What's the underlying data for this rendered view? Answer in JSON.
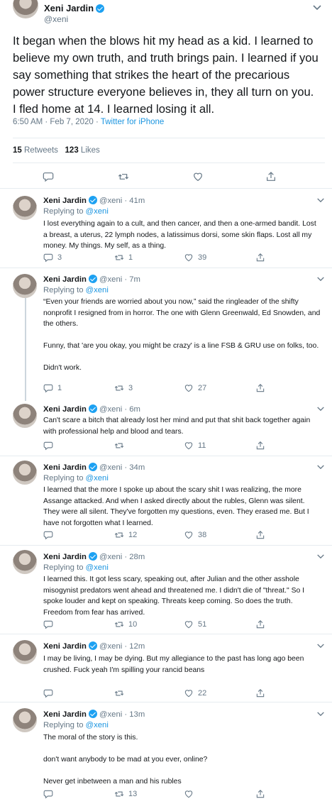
{
  "main": {
    "name": "Xeni Jardin",
    "handle": "@xeni",
    "text": "It began when the blows hit my head as a kid. I learned to believe my own truth, and truth brings pain. I learned if you say something that strikes the heart of the precarious power structure everyone believes in, they all turn on you. I fled home at 14. I learned losing it all.",
    "time": "6:50 AM · Feb 7, 2020 · ",
    "client": "Twitter for iPhone",
    "retweets_count": "15",
    "retweets_label": "Retweets",
    "likes_count": "123",
    "likes_label": "Likes"
  },
  "replies": [
    {
      "name": "Xeni Jardin",
      "handle": "@xeni · 41m",
      "replying_label": "Replying to ",
      "replying_to": "@xeni",
      "text": "I lost everything again to a cult, and then cancer, and then a one-armed bandit. Lost a breast, a uterus, 22 lymph nodes, a latissimus dorsi, some skin flaps. Lost all my money. My things. My self, as a thing.",
      "replies": "3",
      "retweets": "1",
      "likes": "39"
    },
    {
      "name": "Xeni Jardin",
      "handle": "@xeni · 7m",
      "replying_label": "Replying to ",
      "replying_to": "@xeni",
      "text": "“Even your friends are worried about you now,” said the ringleader of the shifty nonprofit I resigned from in horror. The one with Glenn Greenwald, Ed Snowden, and the others.\n\nFunny, that 'are you okay, you might be crazy' is a line FSB & GRU use on folks, too.\n\nDidn't work.",
      "replies": "1",
      "retweets": "3",
      "likes": "27"
    },
    {
      "name": "Xeni Jardin",
      "handle": "@xeni · 6m",
      "text": "Can't scare a bitch that already lost her mind and put that shit back together again with professional help and blood and tears.",
      "replies": "",
      "retweets": "",
      "likes": "11"
    },
    {
      "name": "Xeni Jardin",
      "handle": "@xeni · 34m",
      "replying_label": "Replying to ",
      "replying_to": "@xeni",
      "text": "I learned that the more I spoke up about the scary shit I was realizing, the more Assange attacked. And when I asked directly about the rubles, Glenn was silent. They were all silent. They've forgotten my questions, even. They erased me. But I have not forgotten what I learned.",
      "replies": "",
      "retweets": "12",
      "likes": "38"
    },
    {
      "name": "Xeni Jardin",
      "handle": "@xeni · 28m",
      "replying_label": "Replying to ",
      "replying_to": "@xeni",
      "text": "I learned this. It got less scary, speaking out, after Julian and the other asshole misogynist predators went ahead and threatened me. I didn't die of \"threat.\" So I spoke louder and kept on speaking. Threats keep coming. So does the truth. Freedom from fear has arrived.",
      "replies": "",
      "retweets": "10",
      "likes": "51"
    },
    {
      "name": "Xeni Jardin",
      "handle": "@xeni · 12m",
      "text": "I may be living, I may be dying. But my allegiance to the past has long ago been crushed. Fuck yeah I'm spilling your rancid beans",
      "replies": "",
      "retweets": "",
      "likes": "22"
    },
    {
      "name": "Xeni Jardin",
      "handle": "@xeni · 13m",
      "replying_label": "Replying to ",
      "replying_to": "@xeni",
      "text": "The moral of the story is this.\n\ndon't want anybody to be mad at you ever, online?\n\nNever get inbetween a man and his rubles",
      "replies": "",
      "retweets": "13",
      "likes": ""
    }
  ],
  "colors": {
    "link": "#1b95e0",
    "muted": "#657786",
    "divider": "#e6ecf0",
    "verified": "#1da1f2"
  },
  "icons": [
    "reply-icon",
    "retweet-icon",
    "like-icon",
    "share-icon",
    "verified-icon",
    "chevron-down-icon"
  ]
}
